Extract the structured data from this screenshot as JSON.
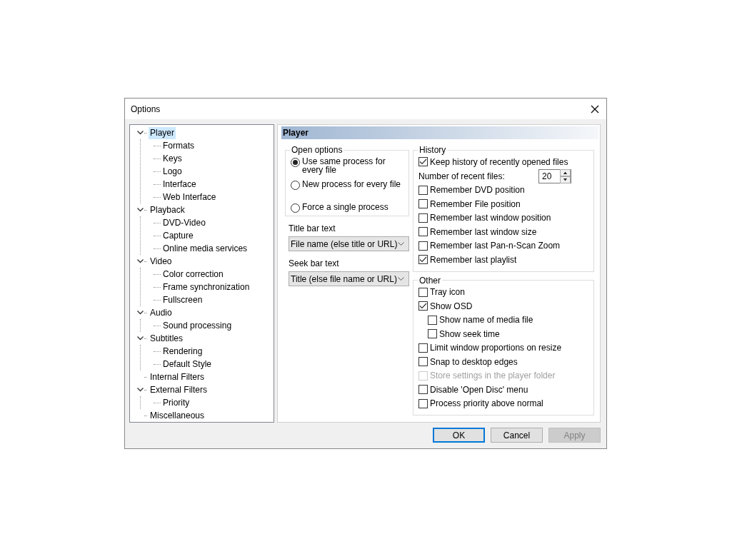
{
  "window": {
    "title": "Options"
  },
  "tree": [
    {
      "label": "Player",
      "selected": true,
      "expanded": true,
      "children": [
        {
          "label": "Formats",
          "selected": false
        },
        {
          "label": "Keys",
          "selected": false
        },
        {
          "label": "Logo",
          "selected": false
        },
        {
          "label": "Interface",
          "selected": false
        },
        {
          "label": "Web Interface",
          "selected": false
        }
      ]
    },
    {
      "label": "Playback",
      "selected": false,
      "expanded": true,
      "children": [
        {
          "label": "DVD-Video",
          "selected": false
        },
        {
          "label": "Capture",
          "selected": false
        },
        {
          "label": "Online media services",
          "selected": false
        }
      ]
    },
    {
      "label": "Video",
      "selected": false,
      "expanded": true,
      "children": [
        {
          "label": "Color correction",
          "selected": false
        },
        {
          "label": "Frame synchronization",
          "selected": false
        },
        {
          "label": "Fullscreen",
          "selected": false
        }
      ]
    },
    {
      "label": "Audio",
      "selected": false,
      "expanded": true,
      "children": [
        {
          "label": "Sound processing",
          "selected": false
        }
      ]
    },
    {
      "label": "Subtitles",
      "selected": false,
      "expanded": true,
      "children": [
        {
          "label": "Rendering",
          "selected": false
        },
        {
          "label": "Default Style",
          "selected": false
        }
      ]
    },
    {
      "label": "Internal Filters",
      "selected": false
    },
    {
      "label": "External Filters",
      "selected": false,
      "expanded": true,
      "children": [
        {
          "label": "Priority",
          "selected": false
        }
      ]
    },
    {
      "label": "Miscellaneous",
      "selected": false
    }
  ],
  "page": {
    "heading": "Player",
    "open_options": {
      "title": "Open options",
      "options": [
        {
          "label": "Use same process for every file",
          "selected": true
        },
        {
          "label": "New process for every file",
          "selected": false
        },
        {
          "label": "Force a single process",
          "selected": false
        }
      ]
    },
    "title_bar_text": {
      "label": "Title bar text",
      "value": "File name (else title or URL)"
    },
    "seek_bar_text": {
      "label": "Seek bar text",
      "value": "Title (else file name or URL)"
    },
    "history": {
      "title": "History",
      "items": [
        {
          "kind": "checkbox",
          "label": "Keep history of recently opened files",
          "checked": true
        },
        {
          "kind": "spinner",
          "label": "Number of recent files:",
          "value": "20"
        },
        {
          "kind": "checkbox",
          "label": "Remember DVD position",
          "checked": false
        },
        {
          "kind": "checkbox",
          "label": "Remember File position",
          "checked": false
        },
        {
          "kind": "checkbox",
          "label": "Remember last window position",
          "checked": false
        },
        {
          "kind": "checkbox",
          "label": "Remember last window size",
          "checked": false
        },
        {
          "kind": "checkbox",
          "label": "Remember last Pan-n-Scan Zoom",
          "checked": false
        },
        {
          "kind": "checkbox",
          "label": "Remember last playlist",
          "checked": true
        }
      ]
    },
    "other": {
      "title": "Other",
      "items": [
        {
          "label": "Tray icon",
          "checked": false,
          "disabled": false
        },
        {
          "label": "Show OSD",
          "checked": true,
          "disabled": false,
          "children": [
            {
              "label": "Show name of media file",
              "checked": false,
              "disabled": false
            },
            {
              "label": "Show seek time",
              "checked": false,
              "disabled": false
            }
          ]
        },
        {
          "label": "Limit window proportions on resize",
          "checked": false,
          "disabled": false
        },
        {
          "label": "Snap to desktop edges",
          "checked": false,
          "disabled": false
        },
        {
          "label": "Store settings in the player folder",
          "checked": false,
          "disabled": true
        },
        {
          "label": "Disable 'Open Disc' menu",
          "checked": false,
          "disabled": false
        },
        {
          "label": "Process priority above normal",
          "checked": false,
          "disabled": false
        }
      ]
    }
  },
  "buttons": [
    {
      "label": "OK",
      "kind": "default",
      "disabled": false
    },
    {
      "label": "Cancel",
      "kind": "normal",
      "disabled": false
    },
    {
      "label": "Apply",
      "kind": "normal",
      "disabled": true
    }
  ]
}
